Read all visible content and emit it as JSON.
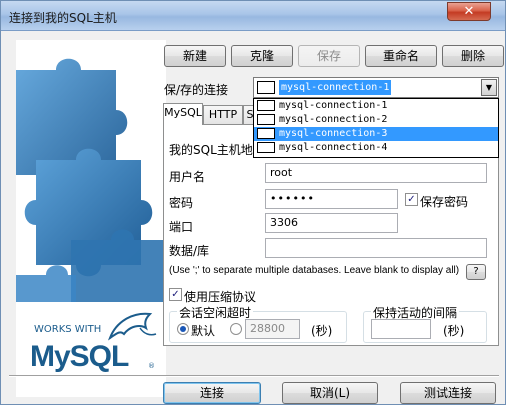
{
  "window": {
    "title": "连接到我的SQL主机",
    "close_label": "✕"
  },
  "toolbar": {
    "new_label": "新建",
    "clone_label": "克隆",
    "save_label": "保存",
    "rename_label": "重命名",
    "delete_label": "删除"
  },
  "saved_connections": {
    "label": "保/存的连接",
    "selected": "mysql-connection-1",
    "options": [
      "mysql-connection-1",
      "mysql-connection-2",
      "mysql-connection-3",
      "mysql-connection-4"
    ],
    "highlighted_index": 2
  },
  "tabs": [
    {
      "label": "MySQL"
    },
    {
      "label": "HTTP"
    },
    {
      "label": "S"
    }
  ],
  "form": {
    "host_label": "我的SQL主机地址",
    "username_label": "用户名",
    "username_value": "root",
    "password_label": "密码",
    "password_value": "••••••",
    "save_password_label": "保存密码",
    "save_password_checked": true,
    "port_label": "端口",
    "port_value": "3306",
    "database_label": "数据/库",
    "database_value": "",
    "database_hint": "(Use ';' to separate multiple databases. Leave blank to display all)",
    "help_label": "?",
    "compression_label": "使用压缩协议",
    "compression_checked": true,
    "idle_timeout_group": "会话空闲超时",
    "default_label": "默认",
    "timeout_value": "28800",
    "seconds_label": "(秒)",
    "keepalive_group": "保持活动的间隔",
    "keepalive_value": "",
    "keepalive_seconds_label": "(秒)"
  },
  "footer": {
    "connect_label": "连接",
    "cancel_label": "取消(L)",
    "test_label": "测试连接"
  },
  "branding": {
    "works_with": "WORKS WITH",
    "logo_text": "MySQL",
    "logo_mark": "®"
  },
  "colors": {
    "selection": "#3399ff",
    "mysql_blue": "#1b5c8c",
    "mysql_orange": "#e48e00",
    "puzzle_blue": "#2d6fa8"
  }
}
